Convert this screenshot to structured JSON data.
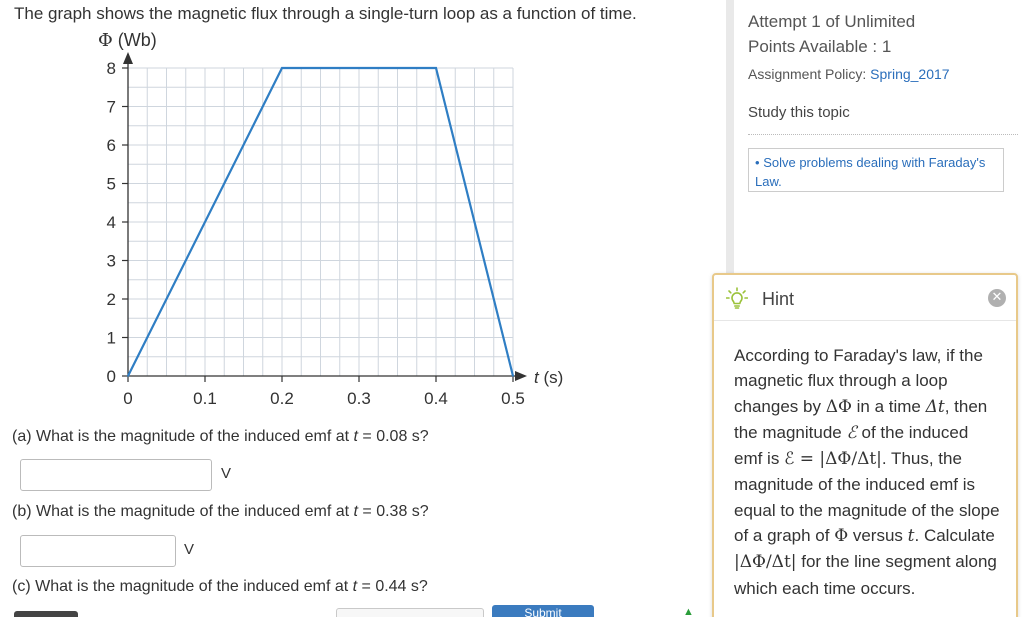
{
  "question": {
    "intro": "The graph shows the magnetic flux through a single-turn loop as a function of time.",
    "parts": [
      {
        "prefix": "(a) What is the magnitude of the induced emf at ",
        "var": "t",
        "suffix": " = 0.08 s?",
        "unit": "V",
        "value": ""
      },
      {
        "prefix": "(b) What is the magnitude of the induced emf at ",
        "var": "t",
        "suffix": " = 0.38 s?",
        "unit": "V",
        "value": ""
      },
      {
        "prefix": "(c) What is the magnitude of the induced emf at ",
        "var": "t",
        "suffix": " = 0.44 s?"
      }
    ],
    "submit_label": "Submit"
  },
  "chart_data": {
    "type": "line",
    "ylabel_sym": "Φ",
    "ylabel_unit": "(Wb)",
    "xlabel_sym": "t",
    "xlabel_unit": "(s)",
    "x_ticks": [
      "0",
      "0.1",
      "0.2",
      "0.3",
      "0.4",
      "0.5"
    ],
    "y_ticks": [
      "0",
      "1",
      "2",
      "3",
      "4",
      "5",
      "6",
      "7",
      "8"
    ],
    "xlim": [
      0,
      0.5
    ],
    "ylim": [
      0,
      8
    ],
    "grid": true,
    "series": [
      {
        "x": [
          0,
          0.2,
          0.4,
          0.5
        ],
        "y": [
          0,
          8,
          8,
          0
        ],
        "color": "#2f7ec4"
      }
    ]
  },
  "sidebar": {
    "attempt": "Attempt 1 of Unlimited",
    "points": "Points Available : 1",
    "policy_label": "Assignment Policy: ",
    "policy_link": "Spring_2017",
    "study_label": "Study this topic",
    "topic_bullet": "•",
    "topic_link": "Solve problems dealing with Faraday's Law."
  },
  "hint": {
    "title": "Hint",
    "close_glyph": "✕",
    "t1": "According to Faraday's law, if the magnetic flux through a loop changes by ",
    "s1": "ΔΦ",
    "t2": " in a time ",
    "s2": "Δt",
    "t3": ", then the magnitude ",
    "s3": "ℰ",
    "t4": " of the induced emf is ",
    "s4": "ℰ = |ΔΦ/Δt|",
    "t5": ". Thus, the magnitude of the induced emf is equal to the magnitude of the slope of a graph of ",
    "s5": "Φ",
    "t6": " versus ",
    "s6": "t",
    "t7": ". Calculate ",
    "s7": "|ΔΦ/Δt|",
    "t8": " for the line segment along which each time occurs."
  },
  "colors": {
    "accent": "#2a6ebb",
    "line": "#2f7ec4",
    "hint_border": "#e8c98a",
    "submit": "#3b7bbf"
  }
}
